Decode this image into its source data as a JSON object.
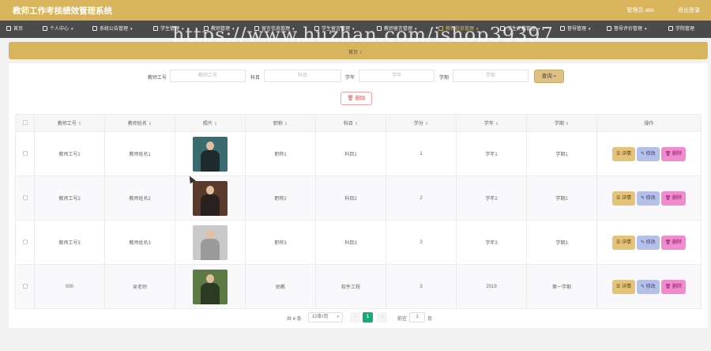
{
  "app": {
    "title": "教师工作考核绩效管理系统",
    "user": "管理员 abo",
    "logout": "退出登录",
    "watermark": "https://www.huzhan.com/ishop39397"
  },
  "nav": [
    {
      "label": "首页",
      "icon": "home-icon",
      "caret": false,
      "active": false
    },
    {
      "label": "个人中心",
      "icon": "user-icon",
      "caret": true,
      "active": false
    },
    {
      "label": "系统公告管理",
      "icon": "notice-icon",
      "caret": true,
      "active": false
    },
    {
      "label": "学生管理",
      "icon": "student-icon",
      "caret": true,
      "active": false
    },
    {
      "label": "教师管理",
      "icon": "teacher-icon",
      "caret": true,
      "active": false
    },
    {
      "label": "留言信息管理",
      "icon": "message-icon",
      "caret": true,
      "active": false
    },
    {
      "label": "学生留言管理",
      "icon": "comment-icon",
      "caret": true,
      "active": false
    },
    {
      "label": "教师留言管理",
      "icon": "list-icon",
      "caret": true,
      "active": false
    },
    {
      "label": "教师信息管理",
      "icon": "info-icon",
      "caret": true,
      "active": true
    },
    {
      "label": "学生评教管理",
      "icon": "evaluate-icon",
      "caret": true,
      "active": false
    },
    {
      "label": "督导管理",
      "icon": "supervisor-icon",
      "caret": true,
      "active": false
    },
    {
      "label": "督导评价管理",
      "icon": "review-icon",
      "caret": true,
      "active": false
    },
    {
      "label": "学院管理",
      "icon": "college-icon",
      "caret": false,
      "active": false
    }
  ],
  "breadcrumb": {
    "home": "首页",
    "sep": "/",
    "current": ""
  },
  "search": {
    "fields": [
      {
        "label": "教师工号",
        "placeholder": "教师工号"
      },
      {
        "label": "科目",
        "placeholder": "科目"
      },
      {
        "label": "学年",
        "placeholder": "学年"
      },
      {
        "label": "学期",
        "placeholder": "学期"
      }
    ],
    "query_label": "查询 ⌕"
  },
  "delete_batch_label": "🗑 删除",
  "table": {
    "columns": [
      "教师工号",
      "教师姓名",
      "照片",
      "职称",
      "科目",
      "学分",
      "学年",
      "学期",
      "操作"
    ],
    "sortable": [
      true,
      true,
      true,
      true,
      true,
      true,
      true,
      true,
      false
    ],
    "rows": [
      {
        "code": "教师工号1",
        "name": "教师姓名1",
        "photo_colors": [
          "#3a6b6e",
          "#1e2a2c"
        ],
        "title": "职称1",
        "subject": "科目1",
        "credit": "1",
        "year": "学年1",
        "term": "学期1"
      },
      {
        "code": "教师工号2",
        "name": "教师姓名2",
        "photo_colors": [
          "#5a3a2c",
          "#2a2220"
        ],
        "title": "职称2",
        "subject": "科目2",
        "credit": "2",
        "year": "学年2",
        "term": "学期2"
      },
      {
        "code": "教师工号3",
        "name": "教师姓名3",
        "photo_colors": [
          "#c9c9c9",
          "#9a9a9a"
        ],
        "title": "职称3",
        "subject": "科目3",
        "credit": "3",
        "year": "学年3",
        "term": "学期3"
      },
      {
        "code": "000",
        "name": "吴老师",
        "photo_colors": [
          "#5d7a45",
          "#2b3a22"
        ],
        "title": "助教",
        "subject": "软件工程",
        "credit": "3",
        "year": "2019",
        "term": "第一学期"
      }
    ],
    "actions": {
      "detail": "详情",
      "edit": "修改",
      "delete": "删除"
    }
  },
  "pagination": {
    "total": "共 4 条",
    "page_size": "10条/页",
    "prev": "‹",
    "current": "1",
    "next": "›",
    "goto_label": "前往",
    "goto_value": "1",
    "page_suffix": "页"
  }
}
